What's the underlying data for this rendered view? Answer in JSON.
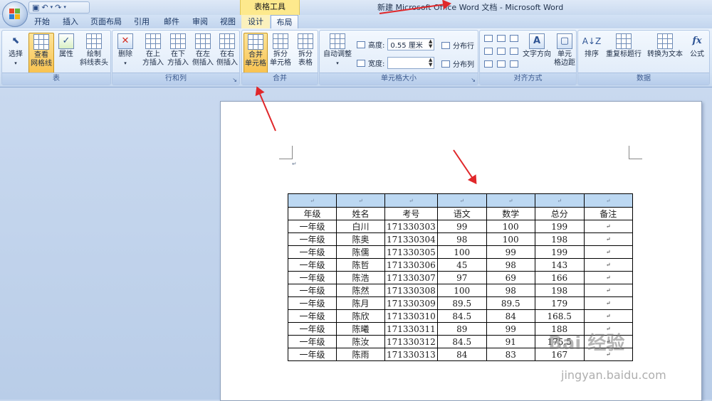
{
  "titlebar": {
    "context_group": "表格工具",
    "window_title": "新建 Microsoft Office Word 文档 - Microsoft Word",
    "qat": [
      "save-icon",
      "undo-icon",
      "redo-icon",
      "customize-icon"
    ]
  },
  "tabs": [
    "开始",
    "插入",
    "页面布局",
    "引用",
    "邮件",
    "审阅",
    "视图",
    "设计",
    "布局"
  ],
  "active_tab": "布局",
  "ribbon": {
    "table_group": {
      "label": "表",
      "select": "选择",
      "gridlines_1": "查看",
      "gridlines_2": "网格线",
      "properties": "属性",
      "draw_1": "绘制",
      "draw_2": "斜线表头"
    },
    "rows_cols_group": {
      "label": "行和列",
      "delete": "删除",
      "above_1": "在上",
      "above_2": "方插入",
      "below_1": "在下",
      "below_2": "方插入",
      "left_1": "在左",
      "left_2": "侧插入",
      "right_1": "在右",
      "right_2": "侧插入"
    },
    "merge_group": {
      "label": "合并",
      "merge_1": "合并",
      "merge_2": "单元格",
      "split_1": "拆分",
      "split_2": "单元格",
      "split_table_1": "拆分",
      "split_table_2": "表格"
    },
    "cell_size_group": {
      "label": "单元格大小",
      "autofit": "自动调整",
      "height_label": "高度:",
      "height_value": "0.55 厘米",
      "width_label": "宽度:",
      "width_value": "",
      "distribute_rows": "分布行",
      "distribute_cols": "分布列"
    },
    "alignment_group": {
      "label": "对齐方式",
      "text_direction": "文字方向",
      "margins_1": "单元",
      "margins_2": "格边距"
    },
    "data_group": {
      "label": "数据",
      "sort": "排序",
      "repeat_header": "重复标题行",
      "convert": "转换为文本",
      "formula": "公式"
    }
  },
  "table": {
    "headers": [
      "年级",
      "姓名",
      "考号",
      "语文",
      "数学",
      "总分",
      "备注"
    ],
    "rows": [
      [
        "一年级",
        "白川",
        "171330303",
        "99",
        "100",
        "199",
        ""
      ],
      [
        "一年级",
        "陈奥",
        "171330304",
        "98",
        "100",
        "198",
        ""
      ],
      [
        "一年级",
        "陈儒",
        "171330305",
        "100",
        "99",
        "199",
        ""
      ],
      [
        "一年级",
        "陈哲",
        "171330306",
        "45",
        "98",
        "143",
        ""
      ],
      [
        "一年级",
        "陈浩",
        "171330307",
        "97",
        "69",
        "166",
        ""
      ],
      [
        "一年级",
        "陈然",
        "171330308",
        "100",
        "98",
        "198",
        ""
      ],
      [
        "一年级",
        "陈月",
        "171330309",
        "89.5",
        "89.5",
        "179",
        ""
      ],
      [
        "一年级",
        "陈欣",
        "171330310",
        "84.5",
        "84",
        "168.5",
        ""
      ],
      [
        "一年级",
        "陈曦",
        "171330311",
        "89",
        "99",
        "188",
        ""
      ],
      [
        "一年级",
        "陈汝",
        "171330312",
        "84.5",
        "91",
        "175.5",
        ""
      ],
      [
        "一年级",
        "陈雨",
        "171330313",
        "84",
        "83",
        "167",
        ""
      ]
    ]
  },
  "watermark": {
    "text": "Bai 经验",
    "url": "jingyan.baidu.com"
  },
  "colors": {
    "accent_arrow": "#e0272a",
    "selection": "#bcd8f2",
    "context_tab": "#fde98d"
  }
}
